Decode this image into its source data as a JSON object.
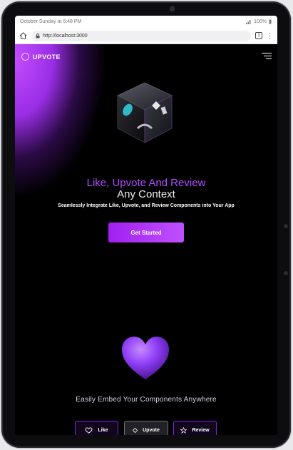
{
  "status_bar": {
    "datetime": "October Sunday at 5:48 PM",
    "battery": "100%"
  },
  "browser": {
    "url": "http://localhost:3000",
    "tab_count": "1"
  },
  "app": {
    "brand": "UPVOTE",
    "hero": {
      "title_line1": "Like, Upvote And Review",
      "title_line2": "Any Context",
      "subtitle": "Seamlessly Integrate Like, Upvote, and Review Components into Your App",
      "cta": "Get Started"
    },
    "embed_heading": "Easily Embed Your Components Anywhere",
    "components": [
      {
        "label": "Like",
        "icon": "heart-outline-icon"
      },
      {
        "label": "Upvote",
        "icon": "diamond-icon"
      },
      {
        "label": "Review",
        "icon": "star-outline-icon"
      }
    ]
  },
  "colors": {
    "accent": "#a020f0",
    "accent_light": "#b04cff",
    "background": "#000000"
  }
}
